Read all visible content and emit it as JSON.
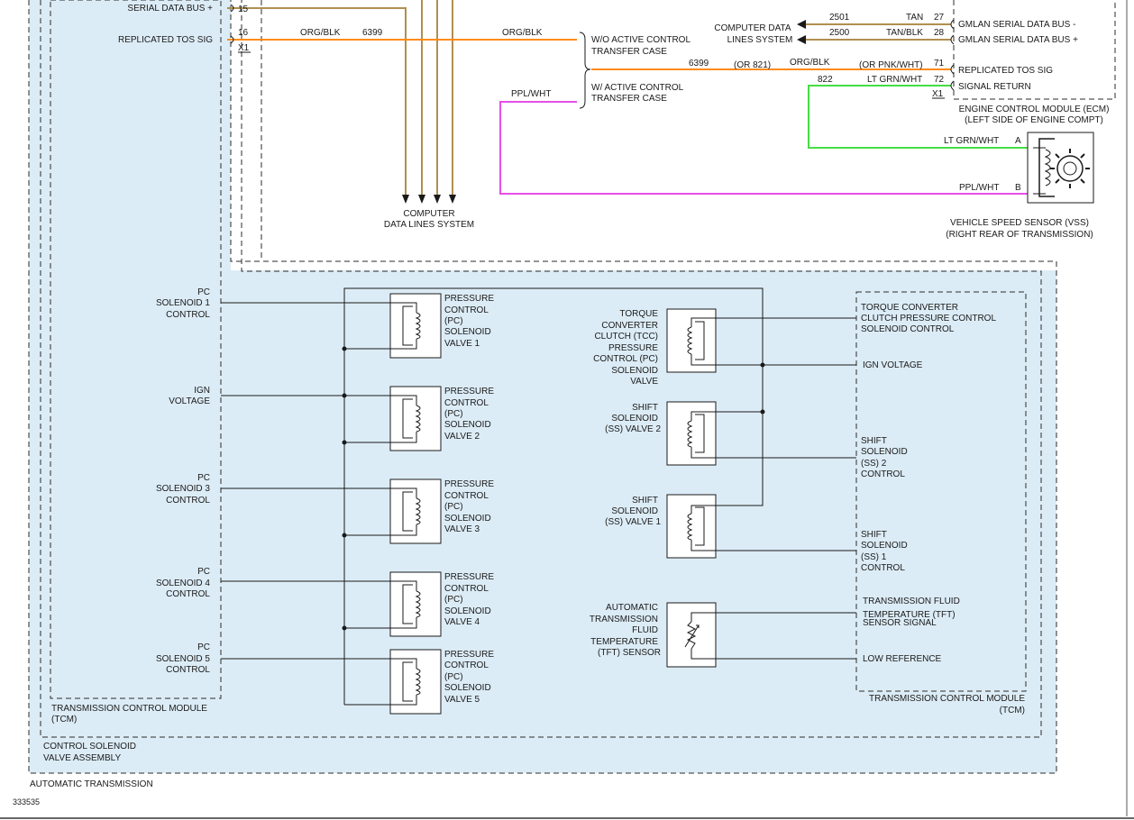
{
  "figure_id": "333535",
  "tcm_connector": {
    "pin15": "15",
    "pin16": "16",
    "connector": "X1",
    "serial_bus": "SERIAL DATA BUS +",
    "replicated_tos": "REPLICATED TOS SIG"
  },
  "upper_wires": {
    "org_blk_1": "ORG/BLK",
    "circuit_6399_1": "6399",
    "org_blk_2": "ORG/BLK",
    "ppl_wht": "PPL/WHT",
    "circuit_6399_2": "6399",
    "or_821": "(OR 821)",
    "org_blk_3": "ORG/BLK",
    "or_pnk_wht": "(OR PNK/WHT)",
    "circuit_822": "822",
    "lt_grn_wht": "LT GRN/WHT"
  },
  "transfer_case": {
    "wo_active": [
      "W/O ACTIVE CONTROL",
      "TRANSFER CASE"
    ],
    "w_active": [
      "W/ ACTIVE CONTROL",
      "TRANSFER CASE"
    ]
  },
  "computer_data_lines_bottom": [
    "COMPUTER",
    "DATA LINES SYSTEM"
  ],
  "computer_data_lines_top": [
    "COMPUTER DATA",
    "LINES SYSTEM"
  ],
  "ecm": {
    "circuit_2501": "2501",
    "circuit_2500": "2500",
    "tan": "TAN",
    "tan_blk": "TAN/BLK",
    "pin27": "27",
    "pin28": "28",
    "pin71": "71",
    "pin72": "72",
    "connector": "X1",
    "gmlan_minus": "GMLAN SERIAL DATA BUS -",
    "gmlan_plus": "GMLAN SERIAL DATA BUS +",
    "replicated_tos": "REPLICATED TOS SIG",
    "signal_return": "SIGNAL RETURN",
    "title": [
      "ENGINE CONTROL MODULE (ECM)",
      "(LEFT SIDE OF ENGINE COMPT)"
    ]
  },
  "vss": {
    "wire_a": "LT GRN/WHT",
    "wire_b": "PPL/WHT",
    "pin_a": "A",
    "pin_b": "B",
    "title": [
      "VEHICLE SPEED SENSOR (VSS)",
      "(RIGHT REAR OF TRANSMISSION)"
    ]
  },
  "tcm_left_labels": [
    [
      "PC",
      "SOLENOID 1",
      "CONTROL"
    ],
    [
      "IGN",
      "VOLTAGE"
    ],
    [
      "PC",
      "SOLENOID 3",
      "CONTROL"
    ],
    [
      "PC",
      "SOLENOID 4",
      "CONTROL"
    ],
    [
      "PC",
      "SOLENOID 5",
      "CONTROL"
    ]
  ],
  "pc_valves": [
    [
      "PRESSURE",
      "CONTROL",
      "(PC)",
      "SOLENOID",
      "VALVE 1"
    ],
    [
      "PRESSURE",
      "CONTROL",
      "(PC)",
      "SOLENOID",
      "VALVE 2"
    ],
    [
      "PRESSURE",
      "CONTROL",
      "(PC)",
      "SOLENOID",
      "VALVE 3"
    ],
    [
      "PRESSURE",
      "CONTROL",
      "(PC)",
      "SOLENOID",
      "VALVE 4"
    ],
    [
      "PRESSURE",
      "CONTROL",
      "(PC)",
      "SOLENOID",
      "VALVE 5"
    ]
  ],
  "center_components": {
    "tcc": [
      "TORQUE",
      "CONVERTER",
      "CLUTCH (TCC)",
      "PRESSURE",
      "CONTROL (PC)",
      "SOLENOID",
      "VALVE"
    ],
    "ss2": [
      "SHIFT",
      "SOLENOID",
      "(SS) VALVE 2"
    ],
    "ss1": [
      "SHIFT",
      "SOLENOID",
      "(SS) VALVE 1"
    ],
    "tft": [
      "AUTOMATIC",
      "TRANSMISSION",
      "FLUID",
      "TEMPERATURE",
      "(TFT) SENSOR"
    ]
  },
  "tcm_right_labels": {
    "tcc_control": [
      "TORQUE CONVERTER",
      "CLUTCH PRESSURE CONTROL",
      "SOLENOID CONTROL"
    ],
    "ign_voltage": "IGN VOLTAGE",
    "ss2_control": [
      "SHIFT",
      "SOLENOID",
      "(SS) 2",
      "CONTROL"
    ],
    "ss1_control": [
      "SHIFT",
      "SOLENOID",
      "(SS) 1",
      "CONTROL"
    ],
    "tft_signal": [
      "TRANSMISSION FLUID",
      "TEMPERATURE (TFT)",
      "SENSOR SIGNAL"
    ],
    "low_reference": "LOW REFERENCE"
  },
  "module_titles": {
    "tcm_left": [
      "TRANSMISSION CONTROL MODULE",
      "(TCM)"
    ],
    "tcm_right": [
      "TRANSMISSION CONTROL MODULE",
      "(TCM)"
    ],
    "solenoid_assembly": [
      "CONTROL SOLENOID",
      "VALVE ASSEMBLY"
    ],
    "automatic_transmission": "AUTOMATIC TRANSMISSION"
  }
}
